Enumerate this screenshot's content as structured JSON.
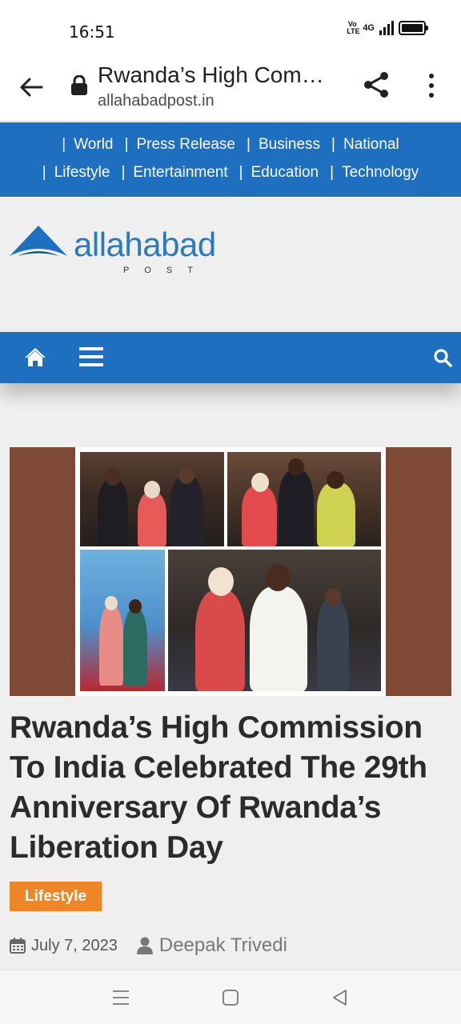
{
  "status_bar": {
    "time": "16:51",
    "volte": "Vo LTE",
    "network": "4G"
  },
  "browser": {
    "page_title": "Rwanda’s High Com…",
    "domain": "allahabadpost.in"
  },
  "top_nav": {
    "row1": [
      "World",
      "Press Release",
      "Business",
      "National"
    ],
    "row2": [
      "Lifestyle",
      "Entertainment",
      "Education",
      "Technology"
    ],
    "separator": "|"
  },
  "logo": {
    "text": "allahabad",
    "subtext": "POST"
  },
  "article": {
    "headline": "Rwanda’s High Commission To India Celebrated The 29th Anniversary Of Rwanda’s Liberation Day",
    "category": "Lifestyle",
    "date": "July 7, 2023",
    "author": "Deepak Trivedi"
  },
  "colors": {
    "nav_blue": "#1f6fc1",
    "logo_blue": "#2a79bf",
    "badge_orange": "#ee8527",
    "image_frame_brown": "#7e4a35"
  }
}
